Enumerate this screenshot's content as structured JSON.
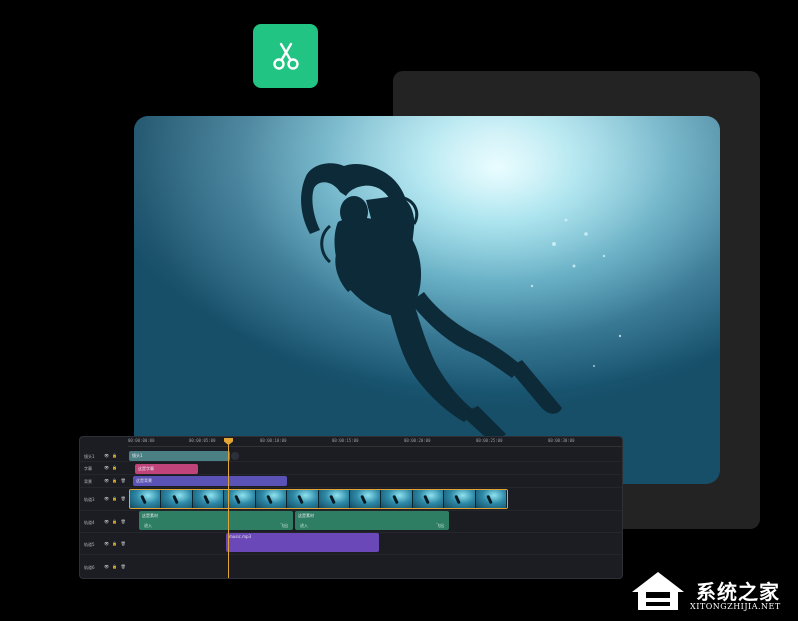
{
  "app_icon": {
    "icon": "scissors-icon",
    "color": "#21c483"
  },
  "timeline": {
    "timecodes": [
      "00:00:00:00",
      "00:00:05:00",
      "00:00:10:00",
      "00:00:15:00",
      "00:00:20:00",
      "00:00:25:00",
      "00:00:30:00"
    ],
    "tracks": [
      {
        "label": "镜头1",
        "clip": "镜头1"
      },
      {
        "label": "字幕",
        "clip": "这是字幕"
      },
      {
        "label": "背景",
        "clip": "这是背景"
      },
      {
        "label": "轨道3",
        "clip": ""
      },
      {
        "label": "轨道4",
        "clips": [
          {
            "title": "这是素材",
            "in": "进入",
            "out": "飞出"
          },
          {
            "title": "这是素材",
            "in": "进入",
            "out": "飞出"
          }
        ]
      },
      {
        "label": "轨道5",
        "clip": "music.mp3"
      },
      {
        "label": "轨道6",
        "clip": ""
      }
    ],
    "colors": {
      "playhead": "#e3a536",
      "background": "#1c1d22"
    }
  },
  "watermark": {
    "title": "系统之家",
    "subtitle": "XITONGZHIJIA.NET"
  }
}
